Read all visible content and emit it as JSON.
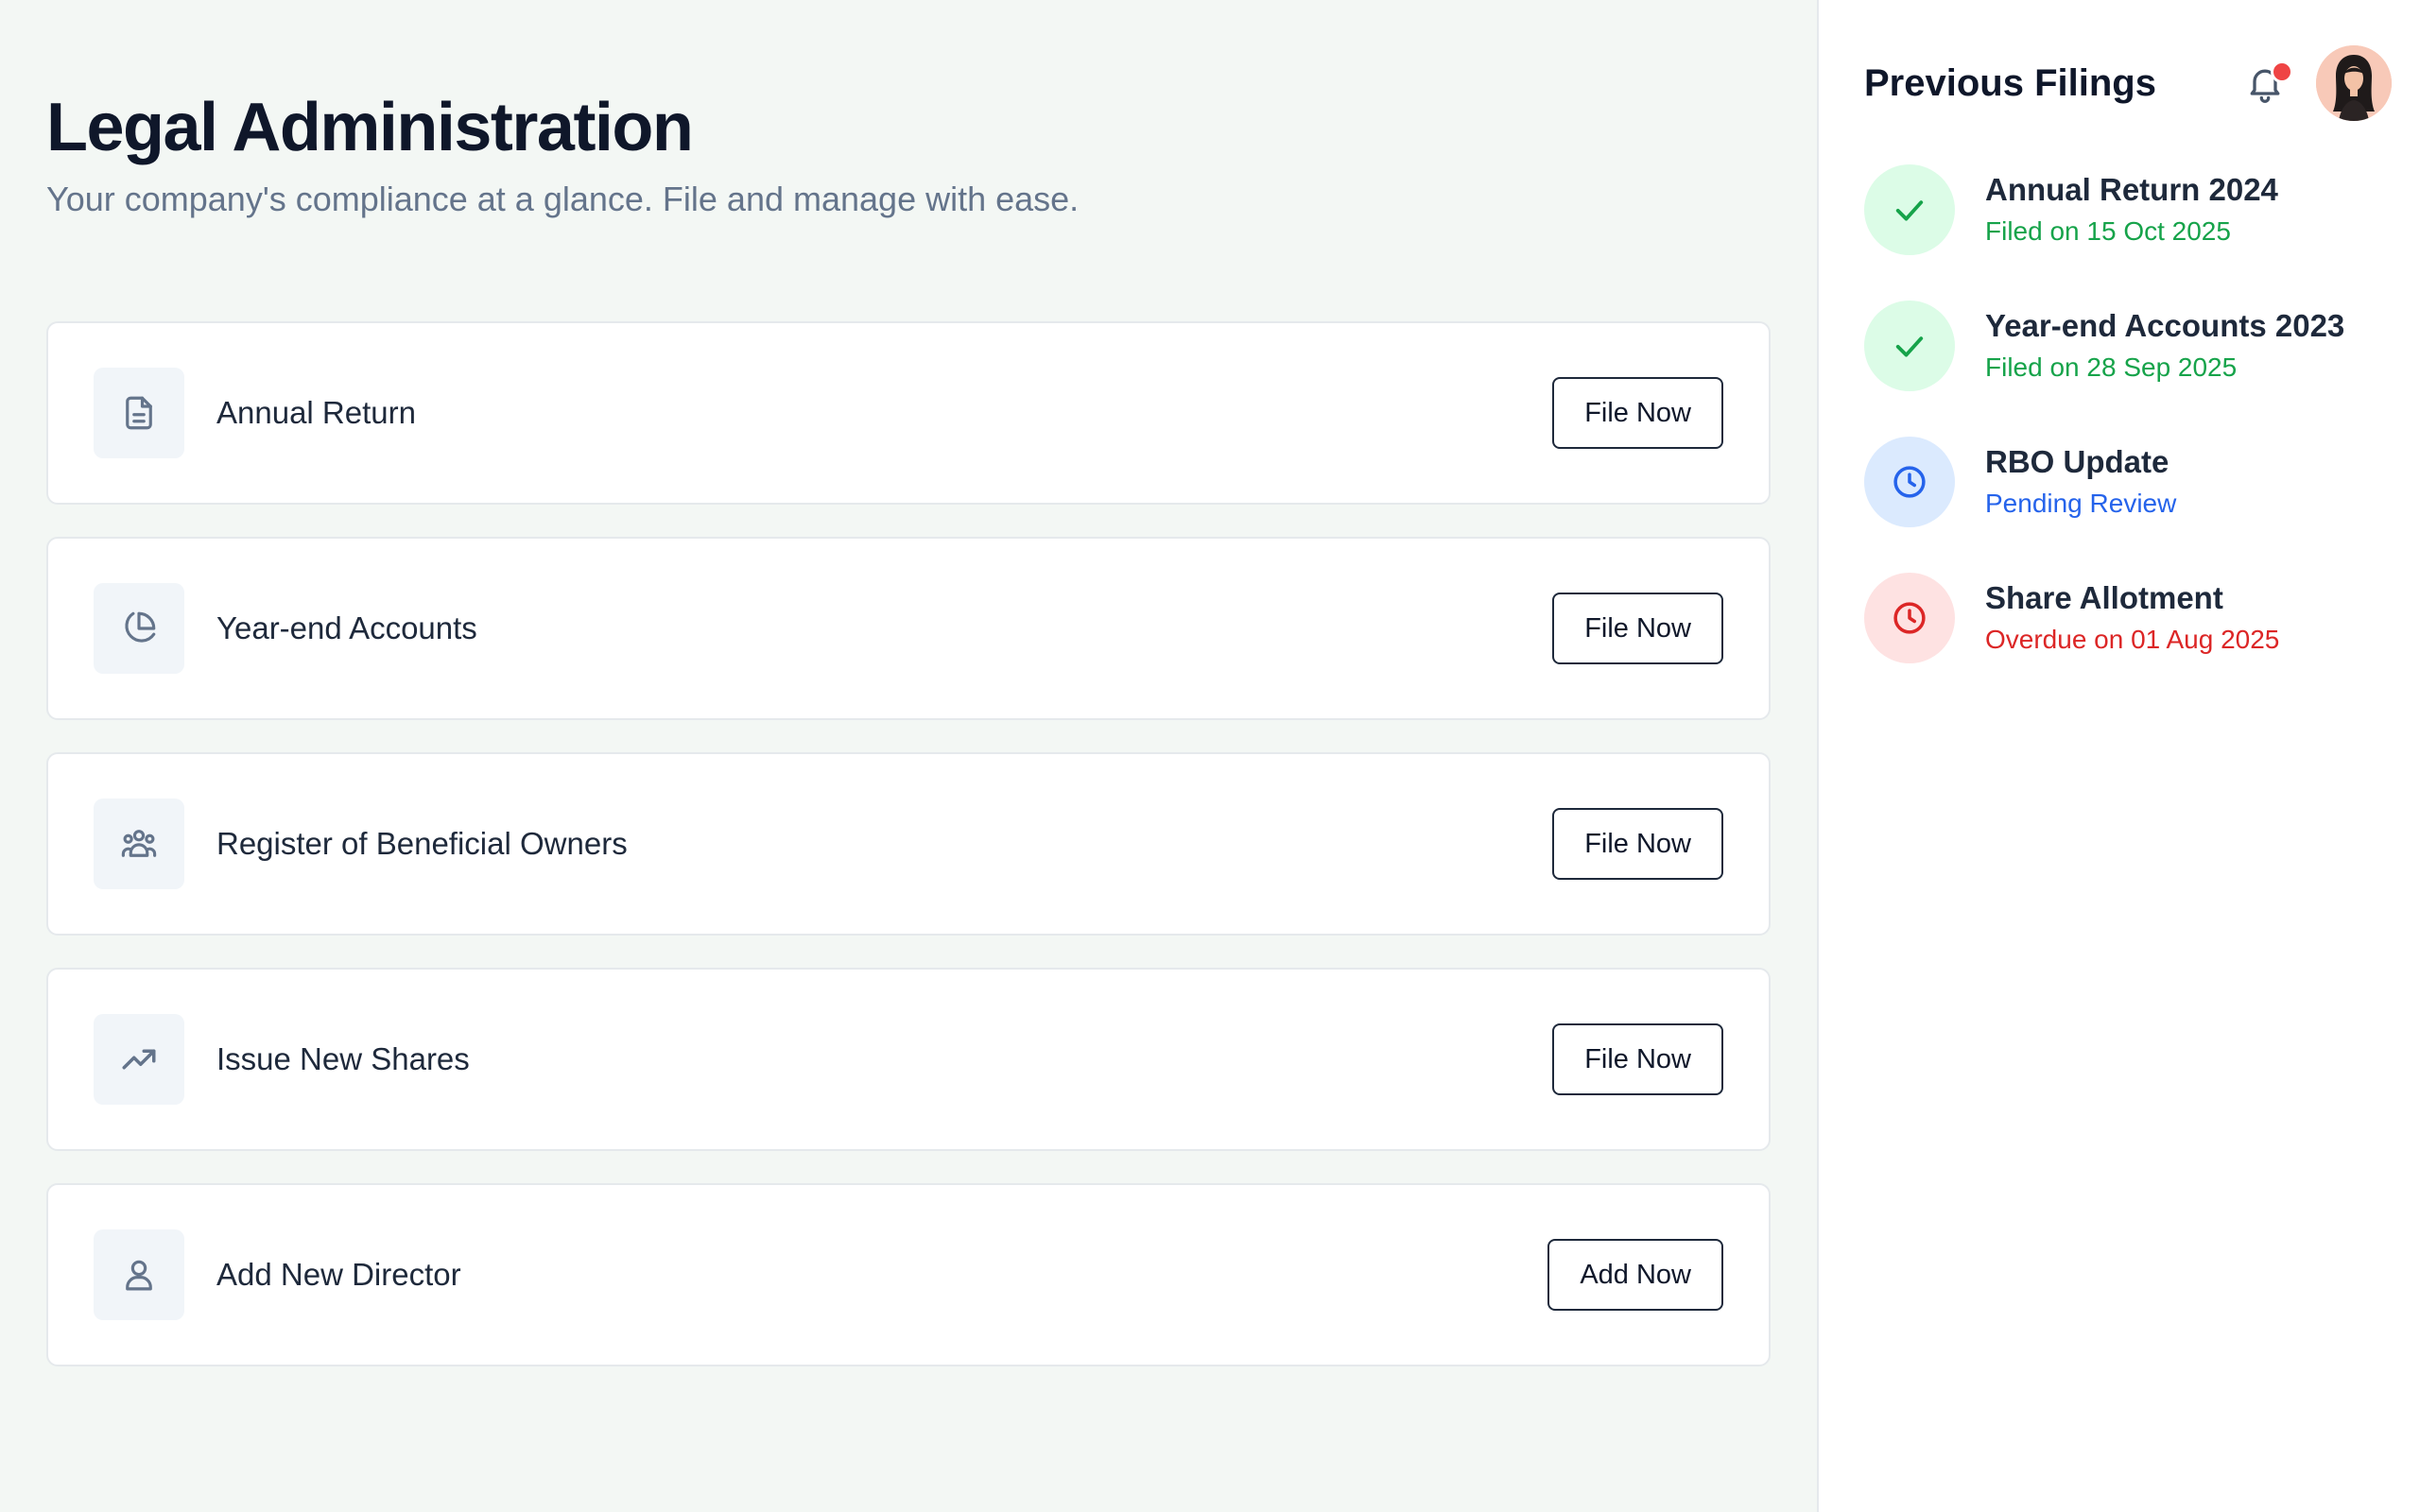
{
  "header": {
    "title": "Legal Administration",
    "subtitle": "Your company's compliance at a glance. File and manage with ease."
  },
  "tasks": [
    {
      "label": "Annual Return",
      "button": "File Now",
      "icon": "document-icon"
    },
    {
      "label": "Year-end Accounts",
      "button": "File Now",
      "icon": "pie-chart-icon"
    },
    {
      "label": "Register of Beneficial Owners",
      "button": "File Now",
      "icon": "users-group-icon"
    },
    {
      "label": "Issue New Shares",
      "button": "File Now",
      "icon": "trending-up-icon"
    },
    {
      "label": "Add New Director",
      "button": "Add Now",
      "icon": "user-icon"
    }
  ],
  "sidebar": {
    "title": "Previous Filings",
    "filings": [
      {
        "title": "Annual Return 2024",
        "status": "Filed on 15 Oct 2025",
        "state": "filed",
        "icon": "check-icon"
      },
      {
        "title": "Year-end Accounts 2023",
        "status": "Filed on 28 Sep 2025",
        "state": "filed",
        "icon": "check-icon"
      },
      {
        "title": "RBO Update",
        "status": "Pending Review",
        "state": "pending",
        "icon": "clock-icon"
      },
      {
        "title": "Share Allotment",
        "status": "Overdue on 01 Aug 2025",
        "state": "overdue",
        "icon": "clock-icon"
      }
    ]
  },
  "colors": {
    "filed": "#16a34a",
    "filed_bg": "#dcfce7",
    "pending": "#2563eb",
    "pending_bg": "#dbeafe",
    "overdue": "#dc2626",
    "overdue_bg": "#fee2e2",
    "notification_dot": "#ef4444"
  }
}
